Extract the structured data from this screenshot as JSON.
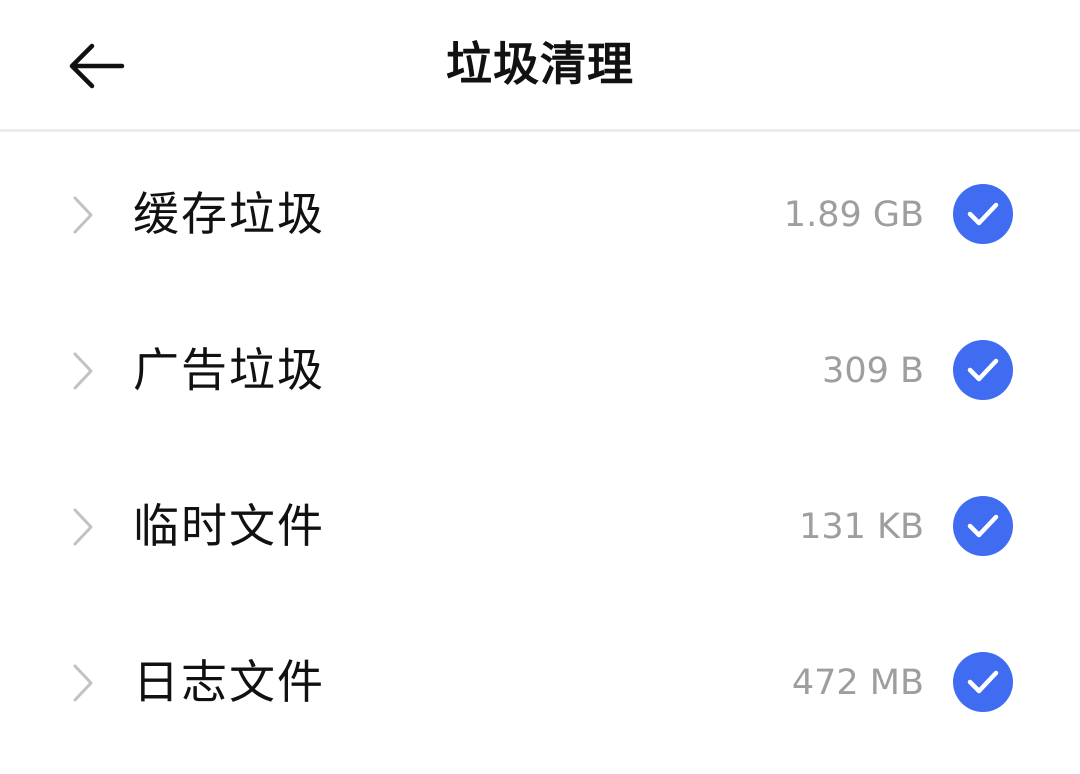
{
  "header": {
    "title": "垃圾清理",
    "back_icon": "back-arrow-icon"
  },
  "theme": {
    "accent": "#3f6cf1",
    "text_primary": "#111111",
    "text_secondary": "#9e9e9e",
    "divider": "#ececec"
  },
  "items": [
    {
      "label": "缓存垃圾",
      "size": "1.89 GB",
      "checked": true
    },
    {
      "label": "广告垃圾",
      "size": "309 B",
      "checked": true
    },
    {
      "label": "临时文件",
      "size": "131 KB",
      "checked": true
    },
    {
      "label": "日志文件",
      "size": "472 MB",
      "checked": true
    }
  ]
}
